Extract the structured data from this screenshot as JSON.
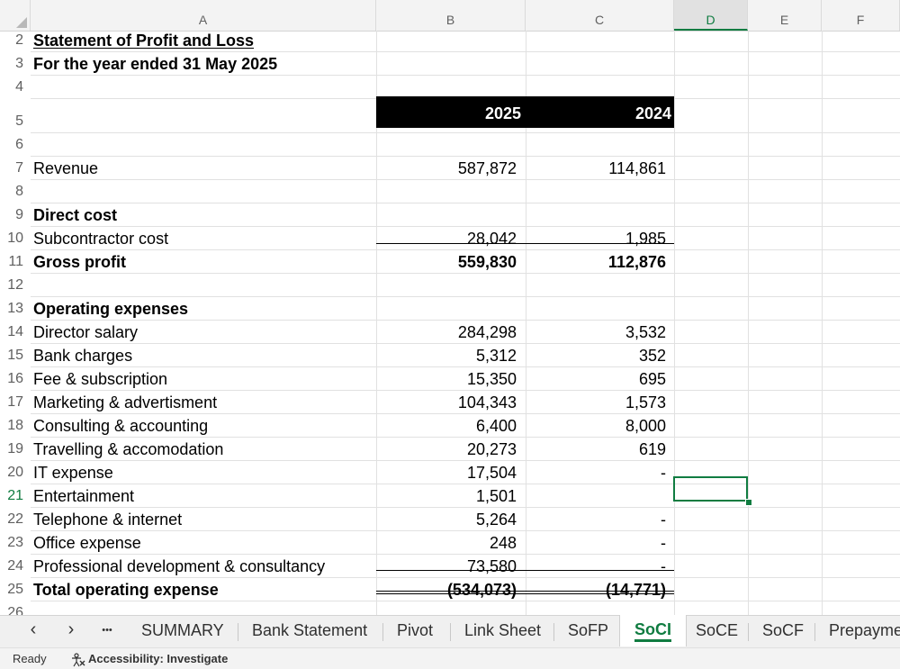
{
  "columns": [
    "A",
    "B",
    "C",
    "D",
    "E",
    "F"
  ],
  "active_column": "D",
  "rows": [
    {
      "num": "2",
      "label": "Statement of Profit and Loss",
      "bold": true,
      "underline": true,
      "b": "",
      "c": ""
    },
    {
      "num": "3",
      "label": "For the year ended 31 May 2025",
      "bold": true,
      "b": "",
      "c": ""
    },
    {
      "num": "4",
      "label": "",
      "b": "",
      "c": ""
    },
    {
      "num": "5",
      "label": "",
      "b": "",
      "c": ""
    },
    {
      "num": "6",
      "label": "",
      "b": "",
      "c": ""
    },
    {
      "num": "7",
      "label": "Revenue",
      "b": "587,872",
      "c": "114,861"
    },
    {
      "num": "8",
      "label": "",
      "b": "",
      "c": ""
    },
    {
      "num": "9",
      "label": "Direct cost",
      "bold": true,
      "b": "",
      "c": ""
    },
    {
      "num": "10",
      "label": "Subcontractor cost",
      "b": "28,042",
      "c": "1,985"
    },
    {
      "num": "11",
      "label": "Gross profit",
      "bold": true,
      "b": "559,830",
      "c": "112,876"
    },
    {
      "num": "12",
      "label": "",
      "b": "",
      "c": ""
    },
    {
      "num": "13",
      "label": "Operating expenses",
      "bold": true,
      "b": "",
      "c": ""
    },
    {
      "num": "14",
      "label": "Director salary",
      "b": "284,298",
      "c": "3,532"
    },
    {
      "num": "15",
      "label": "Bank charges",
      "b": "5,312",
      "c": "352"
    },
    {
      "num": "16",
      "label": "Fee & subscription",
      "b": "15,350",
      "c": "695"
    },
    {
      "num": "17",
      "label": "Marketing & advertisment",
      "b": "104,343",
      "c": "1,573"
    },
    {
      "num": "18",
      "label": "Consulting & accounting",
      "b": "6,400",
      "c": "8,000"
    },
    {
      "num": "19",
      "label": "Travelling & accomodation",
      "b": "20,273",
      "c": "619"
    },
    {
      "num": "20",
      "label": "IT expense",
      "b": "17,504",
      "c": "-"
    },
    {
      "num": "21",
      "label": "Entertainment",
      "b": "1,501",
      "c": "",
      "active": true
    },
    {
      "num": "22",
      "label": "Telephone & internet",
      "b": "5,264",
      "c": "-"
    },
    {
      "num": "23",
      "label": "Office expense",
      "b": "248",
      "c": "-"
    },
    {
      "num": "24",
      "label": "Professional development & consultancy",
      "b": "73,580",
      "c": "-"
    },
    {
      "num": "25",
      "label": "Total operating expense",
      "bold": true,
      "b": "(534,073)",
      "c": "(14,771)"
    },
    {
      "num": "26",
      "label": "",
      "b": "",
      "c": ""
    }
  ],
  "year_header": {
    "current": "2025",
    "prior": "2024"
  },
  "sheet_tabs": [
    "SUMMARY",
    "Bank Statement",
    "Pivot",
    "Link Sheet",
    "SoFP",
    "SoCI",
    "SoCE",
    "SoCF",
    "Prepayme"
  ],
  "active_tab": "SoCI",
  "tab_nav": {
    "prev": "‹",
    "next": "›",
    "more": "•••"
  },
  "status": {
    "ready": "Ready",
    "accessibility": "Accessibility: Investigate"
  },
  "colors": {
    "accent": "#107c41",
    "header_band": "#000000"
  }
}
